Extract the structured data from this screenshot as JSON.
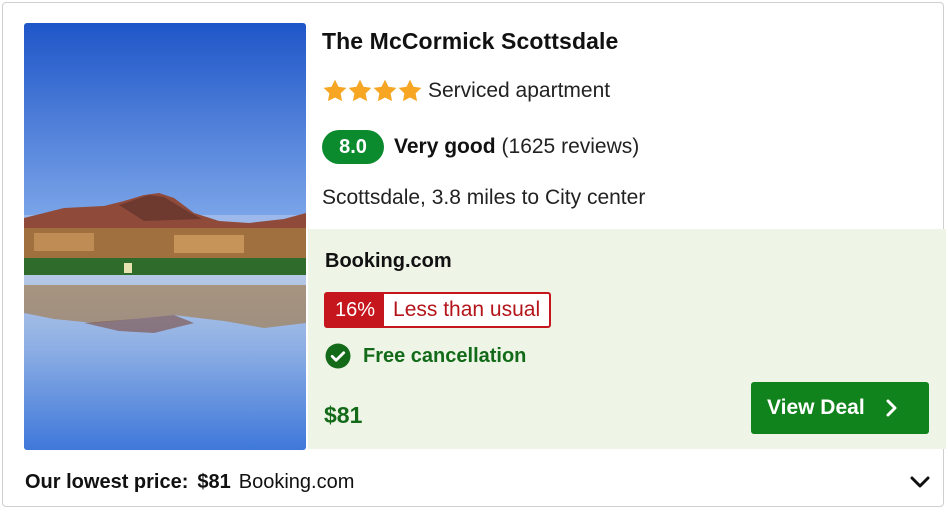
{
  "hotel": {
    "name": "The McCormick Scottsdale",
    "star_rating": 4,
    "property_type": "Serviced apartment",
    "score": "8.0",
    "rating_label": "Very good",
    "reviews": "(1625 reviews)",
    "location": "Scottsdale, 3.8 miles to City center"
  },
  "deal": {
    "provider": "Booking.com",
    "discount_pct": "16%",
    "discount_text": "Less than usual",
    "cancellation": "Free cancellation",
    "price": "$81",
    "button_label": "View Deal"
  },
  "footer": {
    "label": "Our lowest price:",
    "price": "$81",
    "source": "Booking.com"
  },
  "icons": {
    "star": "star-icon",
    "check": "check-circle-icon",
    "view_deal": "chevron-right-icon",
    "expand": "chevron-down-icon"
  },
  "colors": {
    "score_green": "#0b8a2e",
    "deal_bg": "#eef5e6",
    "discount_red": "#c4161c",
    "price_green": "#136b19",
    "button_green": "#10831c",
    "star_orange": "#f6a623"
  }
}
